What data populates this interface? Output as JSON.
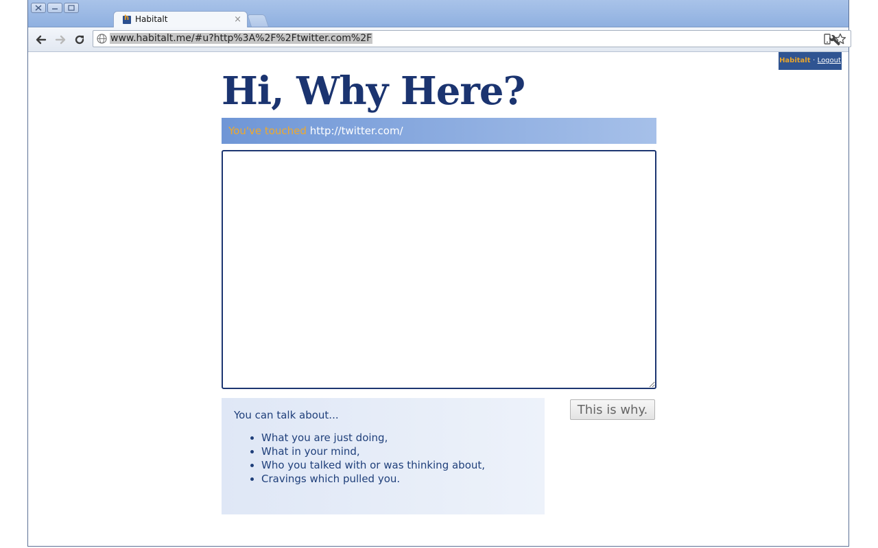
{
  "browser": {
    "tab_title": "Habitalt",
    "tab_close": "×",
    "favicon_letter": "h",
    "url": "www.habitalt.me/#u?http%3A%2F%2Ftwitter.com%2F"
  },
  "userbar": {
    "app_name": "Habitalt",
    "separator": "·",
    "logout_label": "Logout"
  },
  "page": {
    "title": "Hi, Why Here?",
    "touched_label": "You've touched",
    "touched_url": "http://twitter.com/",
    "textarea_value": "",
    "submit_label": "This is why.",
    "hints_intro": "You can talk about...",
    "hints": [
      "What you are just doing,",
      "What in your mind,",
      "Who you talked with or was thinking about,",
      "Cravings which pulled you."
    ]
  },
  "colors": {
    "title": "#1b3470",
    "accent_orange": "#f0a92b",
    "banner_blue": "#6f96d6",
    "userbar_bg": "#2f5492"
  }
}
